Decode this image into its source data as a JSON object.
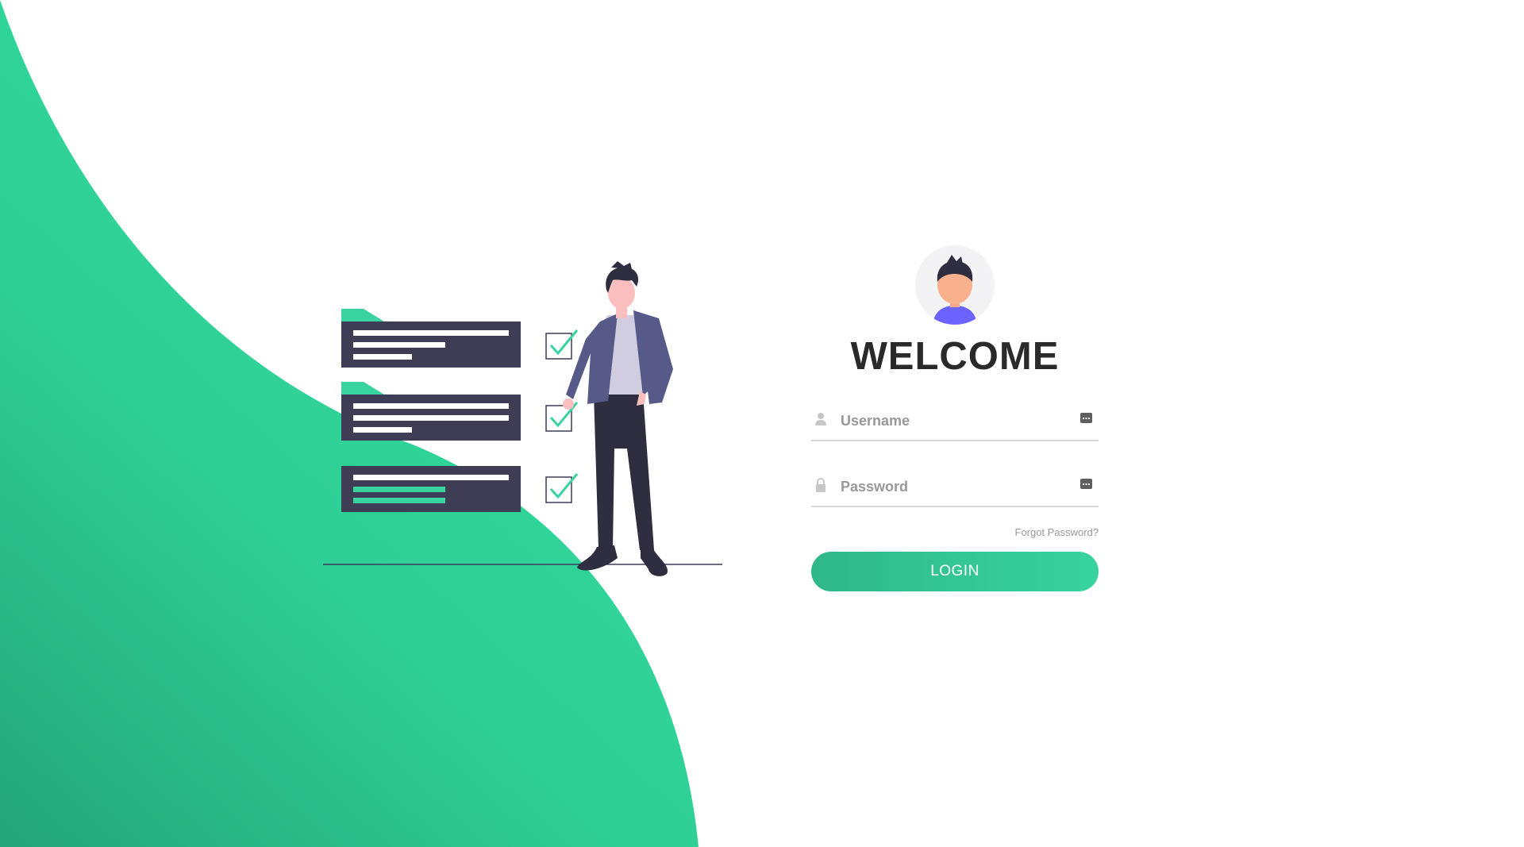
{
  "login": {
    "title": "WELCOME",
    "username_placeholder": "Username",
    "username_value": "",
    "password_placeholder": "Password",
    "password_value": "",
    "forgot_label": "Forgot Password?",
    "login_label": "LOGIN"
  },
  "icons": {
    "username": "user-icon",
    "password": "lock-icon",
    "username_keyboard": "keyboard-icon",
    "password_keyboard": "keyboard-icon",
    "avatar": "avatar-icon"
  },
  "colors": {
    "accent": "#38d39f",
    "accent_dark": "#24a57a",
    "text": "#2a2a2a",
    "muted": "#999999",
    "illustration_dark": "#3f3d56",
    "jacket": "#575a89"
  }
}
